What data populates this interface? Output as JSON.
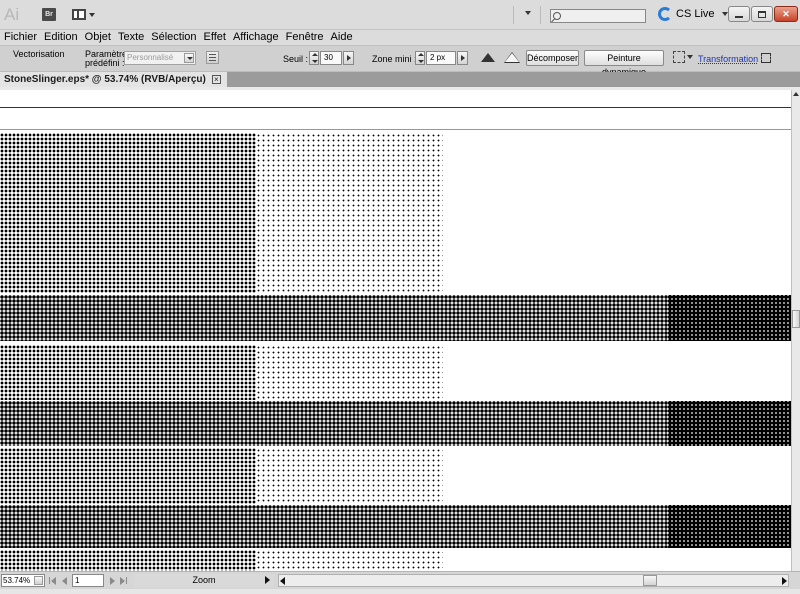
{
  "app": {
    "logo": "Ai",
    "bridge_label": "Br",
    "search_placeholder": "",
    "cslive_label": "CS Live"
  },
  "menu": {
    "items": [
      "Fichier",
      "Edition",
      "Objet",
      "Texte",
      "Sélection",
      "Effet",
      "Affichage",
      "Fenêtre",
      "Aide"
    ]
  },
  "control": {
    "mode_label": "Vectorisation",
    "preset_label": "Paramètre prédéfini :",
    "preset_value": "Personnalisé",
    "threshold_label": "Seuil :",
    "threshold_value": "30",
    "min_area_label": "Zone mini :",
    "min_area_value": "2 px",
    "expand_button": "Décomposer",
    "live_paint_button": "Peinture dynamique",
    "transform_link": "Transformation"
  },
  "document": {
    "tab_title": "StoneSlinger.eps* @ 53.74% (RVB/Aperçu)",
    "tab_close": "×"
  },
  "status": {
    "zoom": "53.74%",
    "page": "1",
    "tool": "Zoom"
  },
  "colors": {
    "chrome": "#dcdcdc",
    "canvas": "#ffffff",
    "guide": "#7a9fc6",
    "link": "#1a33b5",
    "close_button": "#c8432a"
  }
}
